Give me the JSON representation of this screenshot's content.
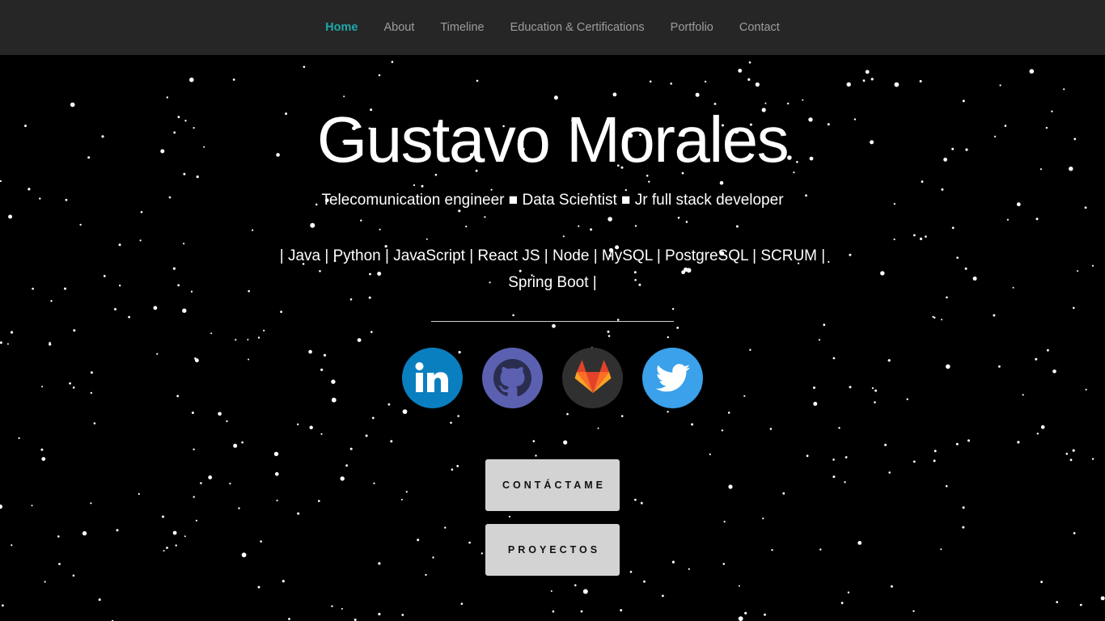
{
  "nav": {
    "items": [
      {
        "label": "Home",
        "active": true
      },
      {
        "label": "About"
      },
      {
        "label": "Timeline"
      },
      {
        "label": "Education & Certifications"
      },
      {
        "label": "Portfolio"
      },
      {
        "label": "Contact"
      }
    ]
  },
  "hero": {
    "name": "Gustavo Morales",
    "subtitle": "Telecomunication engineer ■ Data Scientist ■ Jr full stack developer",
    "skills": "| Java | Python | JavaScript | React JS | Node | MySQL | PostgreSQL | SCRUM | Spring Boot |"
  },
  "social": [
    {
      "name": "linkedin-icon",
      "color": "#0a7fc0"
    },
    {
      "name": "github-icon",
      "color": "#5b61b0"
    },
    {
      "name": "gitlab-icon",
      "color": "#303030"
    },
    {
      "name": "twitter-icon",
      "color": "#3aa1ea"
    }
  ],
  "buttons": {
    "contact_label": "CONTÁCTAME",
    "projects_label": "PROYECTOS"
  },
  "colors": {
    "nav_active": "#1ea7a9",
    "nav_text": "#9d9d9d",
    "navbar_bg": "#262626",
    "background": "#000000",
    "button_bg": "#d3d3d3"
  }
}
